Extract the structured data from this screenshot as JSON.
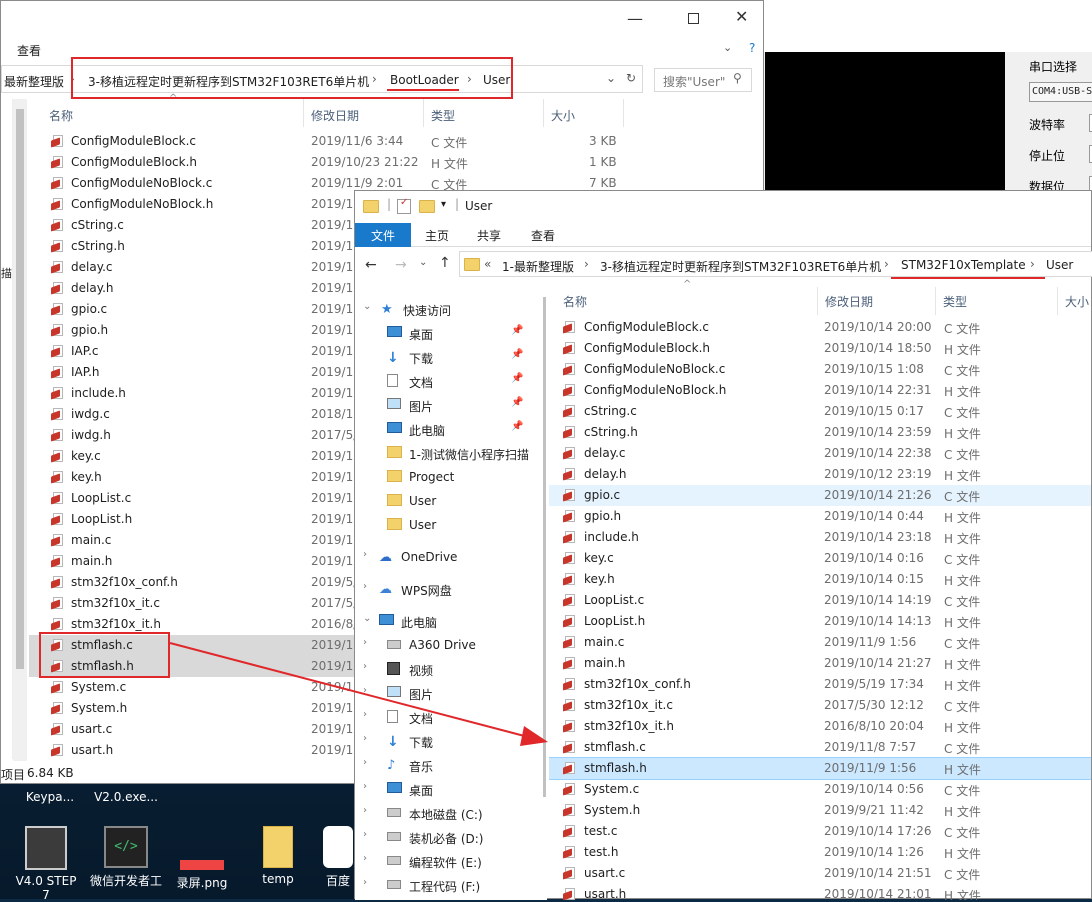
{
  "desktop": {
    "icons": [
      {
        "label": "Keypa..."
      },
      {
        "label": "V2.0.exe..."
      },
      {
        "label": "V4.0 STEP 7"
      },
      {
        "label": "微信开发者工"
      },
      {
        "label": "录屏.png"
      },
      {
        "label": "temp"
      },
      {
        "label": "百度"
      }
    ]
  },
  "serial": {
    "port_label": "串口选择",
    "port_value": "COM4:USB-S",
    "baud_label": "波特率",
    "stop_label": "停止位",
    "data_label": "数据位"
  },
  "back_window": {
    "menu_view": "查看",
    "breadcrumb_start": "最新整理版",
    "breadcrumb": [
      "3-移植远程定时更新程序到STM32F103RET6单片机",
      "BootLoader",
      "User"
    ],
    "search_placeholder": "搜索\"User\"",
    "columns": {
      "name": "名称",
      "date": "修改日期",
      "type": "类型",
      "size": "大小"
    },
    "files": [
      {
        "name": "ConfigModuleBlock.c",
        "date": "2019/11/6 3:44",
        "type": "C 文件",
        "size": "3 KB"
      },
      {
        "name": "ConfigModuleBlock.h",
        "date": "2019/10/23 21:22",
        "type": "H 文件",
        "size": "1 KB"
      },
      {
        "name": "ConfigModuleNoBlock.c",
        "date": "2019/11/9 2:01",
        "type": "C 文件",
        "size": "7 KB"
      },
      {
        "name": "ConfigModuleNoBlock.h",
        "date": "2019/10",
        "type": "",
        "size": ""
      },
      {
        "name": "cString.c",
        "date": "2019/1",
        "type": "",
        "size": ""
      },
      {
        "name": "cString.h",
        "date": "2019/1",
        "type": "",
        "size": ""
      },
      {
        "name": "delay.c",
        "date": "2019/1",
        "type": "",
        "size": ""
      },
      {
        "name": "delay.h",
        "date": "2019/10",
        "type": "",
        "size": ""
      },
      {
        "name": "gpio.c",
        "date": "2019/10",
        "type": "",
        "size": ""
      },
      {
        "name": "gpio.h",
        "date": "2019/10",
        "type": "",
        "size": ""
      },
      {
        "name": "IAP.c",
        "date": "2019/1",
        "type": "",
        "size": ""
      },
      {
        "name": "IAP.h",
        "date": "2019/1",
        "type": "",
        "size": ""
      },
      {
        "name": "include.h",
        "date": "2019/1",
        "type": "",
        "size": ""
      },
      {
        "name": "iwdg.c",
        "date": "2018/1",
        "type": "",
        "size": ""
      },
      {
        "name": "iwdg.h",
        "date": "2017/5/",
        "type": "",
        "size": ""
      },
      {
        "name": "key.c",
        "date": "2019/10",
        "type": "",
        "size": ""
      },
      {
        "name": "key.h",
        "date": "2019/10",
        "type": "",
        "size": ""
      },
      {
        "name": "LoopList.c",
        "date": "2019/10",
        "type": "",
        "size": ""
      },
      {
        "name": "LoopList.h",
        "date": "2019/10",
        "type": "",
        "size": ""
      },
      {
        "name": "main.c",
        "date": "2019/1",
        "type": "",
        "size": ""
      },
      {
        "name": "main.h",
        "date": "2019/1",
        "type": "",
        "size": ""
      },
      {
        "name": "stm32f10x_conf.h",
        "date": "2019/5/",
        "type": "",
        "size": ""
      },
      {
        "name": "stm32f10x_it.c",
        "date": "2017/5/",
        "type": "",
        "size": ""
      },
      {
        "name": "stm32f10x_it.h",
        "date": "2016/8/",
        "type": "",
        "size": ""
      },
      {
        "name": "stmflash.c",
        "date": "2019/1",
        "type": "",
        "size": ""
      },
      {
        "name": "stmflash.h",
        "date": "2019/1",
        "type": "",
        "size": ""
      },
      {
        "name": "System.c",
        "date": "2019/10",
        "type": "",
        "size": ""
      },
      {
        "name": "System.h",
        "date": "2019/10",
        "type": "",
        "size": ""
      },
      {
        "name": "usart.c",
        "date": "2019/1",
        "type": "",
        "size": ""
      },
      {
        "name": "usart.h",
        "date": "2019/1",
        "type": "",
        "size": ""
      }
    ],
    "status_items": "项目",
    "status_size": "6.84 KB",
    "left_fragment": "描"
  },
  "front_window": {
    "title": "User",
    "ribbon_tabs": [
      "文件",
      "主页",
      "共享",
      "查看"
    ],
    "breadcrumb": [
      "1-最新整理版",
      "3-移植远程定时更新程序到STM32F103RET6单片机",
      "STM32F10xTemplate",
      "User"
    ],
    "columns": {
      "name": "名称",
      "date": "修改日期",
      "type": "类型",
      "size": "大小"
    },
    "nav": {
      "quick_access": "快速访问",
      "items": [
        "桌面",
        "下载",
        "文档",
        "图片",
        "此电脑",
        "1-测试微信小程序扫描",
        "Progect",
        "User",
        "User"
      ],
      "onedrive": "OneDrive",
      "wps": "WPS网盘",
      "this_pc": "此电脑",
      "pc_items": [
        "A360 Drive",
        "视频",
        "图片",
        "文档",
        "下载",
        "音乐",
        "桌面",
        "本地磁盘 (C:)",
        "装机必备 (D:)",
        "编程软件 (E:)",
        "工程代码 (F:)"
      ]
    },
    "files": [
      {
        "name": "ConfigModuleBlock.c",
        "date": "2019/10/14 20:00",
        "type": "C 文件"
      },
      {
        "name": "ConfigModuleBlock.h",
        "date": "2019/10/14 18:50",
        "type": "H 文件"
      },
      {
        "name": "ConfigModuleNoBlock.c",
        "date": "2019/10/15 1:08",
        "type": "C 文件"
      },
      {
        "name": "ConfigModuleNoBlock.h",
        "date": "2019/10/14 22:31",
        "type": "H 文件"
      },
      {
        "name": "cString.c",
        "date": "2019/10/15 0:17",
        "type": "C 文件"
      },
      {
        "name": "cString.h",
        "date": "2019/10/14 23:59",
        "type": "H 文件"
      },
      {
        "name": "delay.c",
        "date": "2019/10/14 22:38",
        "type": "C 文件"
      },
      {
        "name": "delay.h",
        "date": "2019/10/12 23:19",
        "type": "H 文件"
      },
      {
        "name": "gpio.c",
        "date": "2019/10/14 21:26",
        "type": "C 文件"
      },
      {
        "name": "gpio.h",
        "date": "2019/10/14 0:44",
        "type": "H 文件"
      },
      {
        "name": "include.h",
        "date": "2019/10/14 23:18",
        "type": "H 文件"
      },
      {
        "name": "key.c",
        "date": "2019/10/14 0:16",
        "type": "C 文件"
      },
      {
        "name": "key.h",
        "date": "2019/10/14 0:15",
        "type": "H 文件"
      },
      {
        "name": "LoopList.c",
        "date": "2019/10/14 14:19",
        "type": "C 文件"
      },
      {
        "name": "LoopList.h",
        "date": "2019/10/14 14:13",
        "type": "H 文件"
      },
      {
        "name": "main.c",
        "date": "2019/11/9 1:56",
        "type": "C 文件"
      },
      {
        "name": "main.h",
        "date": "2019/10/14 21:27",
        "type": "H 文件"
      },
      {
        "name": "stm32f10x_conf.h",
        "date": "2019/5/19 17:34",
        "type": "H 文件"
      },
      {
        "name": "stm32f10x_it.c",
        "date": "2017/5/30 12:12",
        "type": "C 文件"
      },
      {
        "name": "stm32f10x_it.h",
        "date": "2016/8/10 20:04",
        "type": "H 文件"
      },
      {
        "name": "stmflash.c",
        "date": "2019/11/8 7:57",
        "type": "C 文件"
      },
      {
        "name": "stmflash.h",
        "date": "2019/11/9 1:56",
        "type": "H 文件"
      },
      {
        "name": "System.c",
        "date": "2019/10/14 0:56",
        "type": "C 文件"
      },
      {
        "name": "System.h",
        "date": "2019/9/21 11:42",
        "type": "H 文件"
      },
      {
        "name": "test.c",
        "date": "2019/10/14 17:26",
        "type": "C 文件"
      },
      {
        "name": "test.h",
        "date": "2019/10/14 1:26",
        "type": "H 文件"
      },
      {
        "name": "usart.c",
        "date": "2019/10/14 21:51",
        "type": "C 文件"
      },
      {
        "name": "usart.h",
        "date": "2019/10/14 21:01",
        "type": "H 文件"
      }
    ]
  },
  "colors": {
    "annotation_red": "#e0282b",
    "ribbon_blue": "#1979ca",
    "selection_blue": "#cce8ff",
    "hover_blue": "#e5f3ff"
  }
}
